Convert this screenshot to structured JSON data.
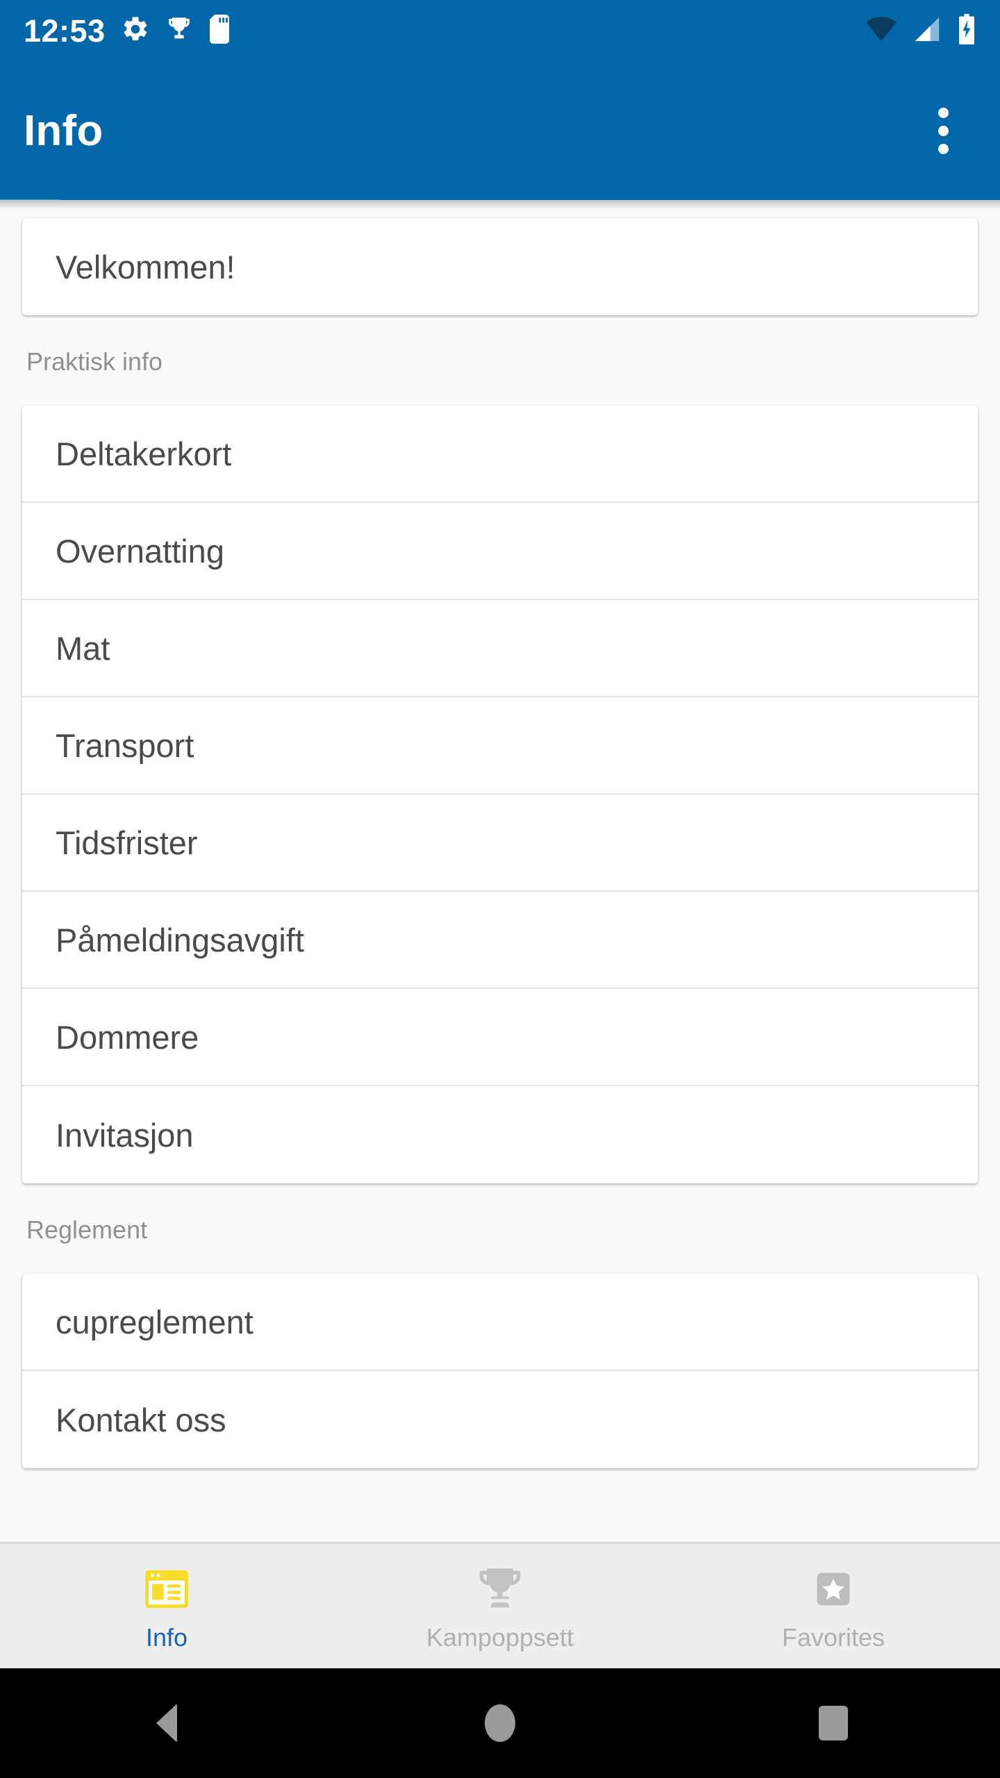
{
  "status_bar": {
    "time": "12:53",
    "left_icons": [
      "gear-icon",
      "trophy-icon",
      "sd-card-icon"
    ],
    "right_icons": [
      "wifi-icon",
      "cellular-signal-icon",
      "battery-charging-icon"
    ]
  },
  "app_bar": {
    "title": "Info",
    "overflow_menu": "more-options"
  },
  "welcome_card": {
    "label": "Velkommen!"
  },
  "sections": [
    {
      "header": "Praktisk info",
      "items": [
        {
          "label": "Deltakerkort"
        },
        {
          "label": "Overnatting"
        },
        {
          "label": "Mat"
        },
        {
          "label": "Transport"
        },
        {
          "label": "Tidsfrister"
        },
        {
          "label": "Påmeldingsavgift"
        },
        {
          "label": "Dommere"
        },
        {
          "label": "Invitasjon"
        }
      ]
    },
    {
      "header": "Reglement",
      "items": [
        {
          "label": "cupreglement"
        },
        {
          "label": "Kontakt oss"
        }
      ]
    }
  ],
  "bottom_nav": {
    "tabs": [
      {
        "label": "Info",
        "icon": "article-window-icon",
        "active": true
      },
      {
        "label": "Kampoppsett",
        "icon": "trophy-icon",
        "active": false
      },
      {
        "label": "Favorites",
        "icon": "star-box-icon",
        "active": false
      }
    ]
  },
  "android_nav": {
    "back": "back-button",
    "home": "home-button",
    "recents": "recents-button"
  },
  "colors": {
    "primary_blue": "#0267a8",
    "accent_yellow": "#f5dd2a",
    "active_label_blue": "#1668b3",
    "inactive_grey": "#b0b0b0",
    "card_white": "#ffffff",
    "page_background": "#fafafa"
  }
}
